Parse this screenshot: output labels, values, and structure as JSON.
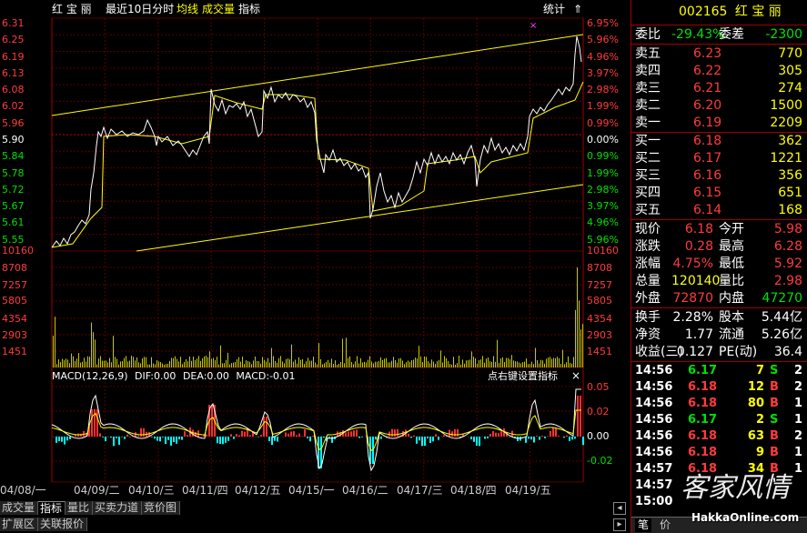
{
  "header": {
    "stock_name": "红 宝 丽",
    "period": "最近10日分时",
    "avg_line": "均线",
    "volume": "成交量",
    "indicator": "指标",
    "stats": "统计",
    "up_arrow": "⇑"
  },
  "price_axis": {
    "left": [
      "6.31",
      "6.25",
      "6.19",
      "6.13",
      "6.08",
      "6.02",
      "5.96",
      "5.90",
      "5.84",
      "5.78",
      "5.72",
      "5.67",
      "5.61",
      "5.55"
    ],
    "right": [
      "6.95%",
      "5.96%",
      "4.96%",
      "3.97%",
      "2.98%",
      "1.99%",
      "0.99%",
      "0.00%",
      "0.99%",
      "1.99%",
      "2.98%",
      "3.97%",
      "4.96%",
      "5.96%"
    ]
  },
  "volume_axis": {
    "left": [
      "10160",
      "8708",
      "7257",
      "5805",
      "4354",
      "2903",
      "1451"
    ],
    "right": [
      "10160",
      "8708",
      "7257",
      "5805",
      "4354",
      "2903",
      "1451"
    ]
  },
  "macd": {
    "title": "MACD(12,26,9)",
    "dif": "DIF:0.00",
    "dea": "DEA:0.00",
    "macd": "MACD:-0.01",
    "hint": "点右键设置指标",
    "close": "×",
    "axis": [
      "0.05",
      "0.02",
      "0.00",
      "-0.02"
    ]
  },
  "x_labels": [
    "04/08/一",
    "04/09/二",
    "04/10/三",
    "04/11/四",
    "04/12/五",
    "04/15/一",
    "04/16/二",
    "04/17/三",
    "04/18/四",
    "04/19/五"
  ],
  "bottom_tabs": [
    "成交量",
    "指标",
    "量比",
    "买卖力道",
    "竞价图"
  ],
  "bottom_tabs2": [
    "扩展区",
    "关联报价"
  ],
  "quote": {
    "code": "002165",
    "name": "红 宝 丽",
    "weibi_label": "委比",
    "weibi": "-29.43%",
    "weicha_label": "委差",
    "weicha": "-2300",
    "sell": [
      {
        "label": "卖五",
        "price": "6.23",
        "vol": "770"
      },
      {
        "label": "卖四",
        "price": "6.22",
        "vol": "305"
      },
      {
        "label": "卖三",
        "price": "6.21",
        "vol": "274"
      },
      {
        "label": "卖二",
        "price": "6.20",
        "vol": "1500"
      },
      {
        "label": "卖一",
        "price": "6.19",
        "vol": "2209"
      }
    ],
    "buy": [
      {
        "label": "买一",
        "price": "6.18",
        "vol": "362"
      },
      {
        "label": "买二",
        "price": "6.17",
        "vol": "1221"
      },
      {
        "label": "买三",
        "price": "6.16",
        "vol": "356"
      },
      {
        "label": "买四",
        "price": "6.15",
        "vol": "651"
      },
      {
        "label": "买五",
        "price": "6.14",
        "vol": "168"
      }
    ],
    "stats": [
      [
        {
          "l": "现价",
          "v": "6.18",
          "c": "red"
        },
        {
          "l": "今开",
          "v": "5.98",
          "c": "red"
        }
      ],
      [
        {
          "l": "涨跌",
          "v": "0.28",
          "c": "red"
        },
        {
          "l": "最高",
          "v": "6.28",
          "c": "red"
        }
      ],
      [
        {
          "l": "涨幅",
          "v": "4.75%",
          "c": "red"
        },
        {
          "l": "最低",
          "v": "5.92",
          "c": "red"
        }
      ],
      [
        {
          "l": "总量",
          "v": "120140",
          "c": "yel"
        },
        {
          "l": "量比",
          "v": "2.98",
          "c": "red"
        }
      ],
      [
        {
          "l": "外盘",
          "v": "72870",
          "c": "red"
        },
        {
          "l": "内盘",
          "v": "47270",
          "c": "grn"
        }
      ]
    ],
    "stats2": [
      [
        {
          "l": "换手",
          "v": "2.28%",
          "c": "wht"
        },
        {
          "l": "股本",
          "v": "5.44亿",
          "c": "wht"
        }
      ],
      [
        {
          "l": "净资",
          "v": "1.77",
          "c": "wht"
        },
        {
          "l": "流通",
          "v": "5.26亿",
          "c": "wht"
        }
      ],
      [
        {
          "l": "收益(三)",
          "v": "0.127",
          "c": "wht"
        },
        {
          "l": "PE(动)",
          "v": "36.4",
          "c": "wht"
        }
      ]
    ],
    "ticks": [
      {
        "t": "14:56",
        "p": "6.17",
        "v": "7",
        "s": "S",
        "n": "2"
      },
      {
        "t": "14:56",
        "p": "6.18",
        "v": "12",
        "s": "B",
        "n": "2"
      },
      {
        "t": "14:56",
        "p": "6.18",
        "v": "80",
        "s": "B",
        "n": "1"
      },
      {
        "t": "14:56",
        "p": "6.17",
        "v": "2",
        "s": "S",
        "n": "1"
      },
      {
        "t": "14:56",
        "p": "6.18",
        "v": "63",
        "s": "B",
        "n": "2"
      },
      {
        "t": "14:56",
        "p": "6.18",
        "v": "9",
        "s": "B",
        "n": "1"
      },
      {
        "t": "14:57",
        "p": "6.18",
        "v": "34",
        "s": "B",
        "n": "1"
      },
      {
        "t": "14:57",
        "p": "",
        "v": "",
        "s": "",
        "n": ""
      },
      {
        "t": "15:00",
        "p": "",
        "v": "",
        "s": "",
        "n": ""
      }
    ],
    "tabs": [
      "笔",
      "价"
    ]
  },
  "watermark": {
    "brand": "客家风情",
    "url": "HakkaOnline.com"
  },
  "colors": {
    "red": "#ff3b3b",
    "green": "#00e000",
    "yellow": "#ffff00",
    "grid": "#a00000",
    "price_line": "#ffffff",
    "avg_line": "#ffff00",
    "volume": "#c8c800",
    "macd_pos": "#ff3030",
    "macd_neg": "#00ffff"
  }
}
